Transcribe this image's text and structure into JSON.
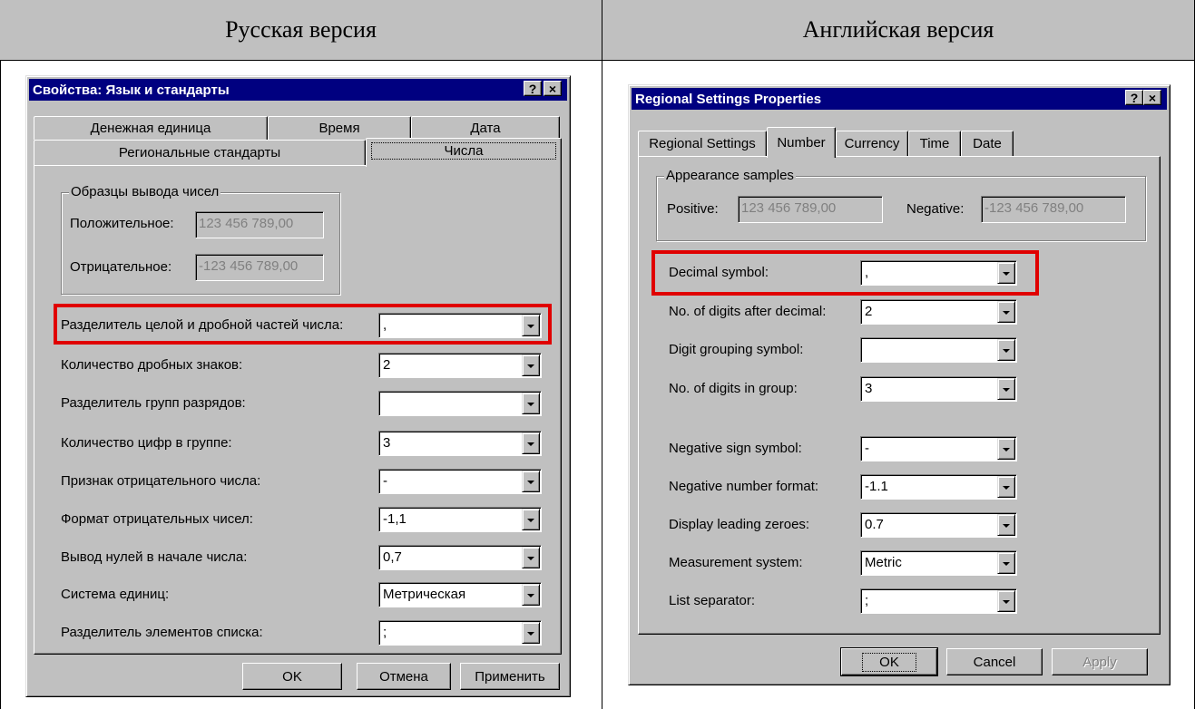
{
  "headers": {
    "left": "Русская версия",
    "right": "Английская версия"
  },
  "ru": {
    "title": "Свойства: Язык и стандарты",
    "title_help": "?",
    "title_close": "×",
    "tabs_back": [
      "Денежная единица",
      "Время",
      "Дата"
    ],
    "tabs_front": [
      "Региональные стандарты",
      "Числа"
    ],
    "samples_legend": "Образцы вывода чисел",
    "positive_label": "Положительное:",
    "positive_value": "123 456 789,00",
    "negative_label": "Отрицательное:",
    "negative_value": "-123 456 789,00",
    "fields": [
      {
        "label": "Разделитель целой и дробной частей числа:",
        "value": ","
      },
      {
        "label": "Количество дробных знаков:",
        "value": "2"
      },
      {
        "label": "Разделитель групп разрядов:",
        "value": ""
      },
      {
        "label": "Количество цифр в группе:",
        "value": "3"
      },
      {
        "label": "Признак отрицательного числа:",
        "value": "-"
      },
      {
        "label": "Формат отрицательных чисел:",
        "value": "-1,1"
      },
      {
        "label": "Вывод нулей в начале числа:",
        "value": "0,7"
      },
      {
        "label": "Система единиц:",
        "value": "Метрическая"
      },
      {
        "label": "Разделитель элементов списка:",
        "value": ";"
      }
    ],
    "ok": "OK",
    "cancel": "Отмена",
    "apply": "Применить"
  },
  "en": {
    "title": "Regional Settings Properties",
    "title_help": "?",
    "title_close": "×",
    "tabs": [
      "Regional Settings",
      "Number",
      "Currency",
      "Time",
      "Date"
    ],
    "samples_legend": "Appearance samples",
    "positive_label": "Positive:",
    "positive_value": "123 456 789,00",
    "negative_label": "Negative:",
    "negative_value": "-123 456 789,00",
    "fields": [
      {
        "label": "Decimal symbol:",
        "value": ","
      },
      {
        "label": "No. of digits after decimal:",
        "value": "2"
      },
      {
        "label": "Digit grouping symbol:",
        "value": ""
      },
      {
        "label": "No. of digits in group:",
        "value": "3"
      },
      {
        "label": "Negative sign symbol:",
        "value": "-"
      },
      {
        "label": "Negative number format:",
        "value": "-1.1"
      },
      {
        "label": "Display leading zeroes:",
        "value": "0.7"
      },
      {
        "label": "Measurement system:",
        "value": "Metric"
      },
      {
        "label": "List separator:",
        "value": ";"
      }
    ],
    "ok": "OK",
    "cancel": "Cancel",
    "apply": "Apply"
  },
  "colors": {
    "highlight": "#e00000",
    "titlebar": "#000080",
    "face": "#c0c0c0"
  }
}
